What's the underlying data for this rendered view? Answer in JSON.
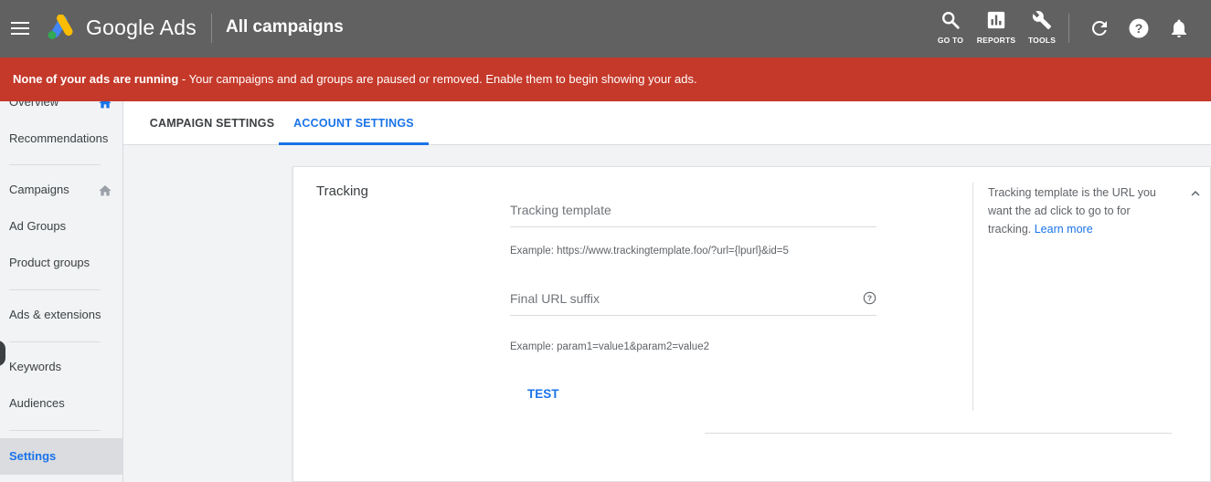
{
  "header": {
    "brand": "Google Ads",
    "page_title": "All campaigns",
    "tools": [
      {
        "label": "GO TO",
        "icon": "search-icon"
      },
      {
        "label": "REPORTS",
        "icon": "bar-chart-icon"
      },
      {
        "label": "TOOLS",
        "icon": "wrench-icon"
      }
    ],
    "icons": [
      "refresh-icon",
      "help-icon",
      "notifications-bell-icon"
    ]
  },
  "alert": {
    "bold": "None of your ads are running",
    "message": " - Your campaigns and ad groups are paused or removed. Enable them to begin showing your ads.",
    "color": "#c5392a"
  },
  "sidebar": {
    "items": [
      {
        "label": "Overview"
      },
      {
        "label": "Recommendations"
      },
      {
        "label": "Campaigns"
      },
      {
        "label": "Ad Groups"
      },
      {
        "label": "Product groups"
      },
      {
        "label": "Ads & extensions"
      },
      {
        "label": "Keywords"
      },
      {
        "label": "Audiences"
      },
      {
        "label": "Settings",
        "active": true
      }
    ]
  },
  "tabs": [
    {
      "label": "CAMPAIGN SETTINGS",
      "active": false
    },
    {
      "label": "ACCOUNT SETTINGS",
      "active": true
    }
  ],
  "tracking": {
    "section_title": "Tracking",
    "template_placeholder": "Tracking template",
    "template_value": "",
    "template_example": "Example: https://www.trackingtemplate.foo/?url={lpurl}&id=5",
    "suffix_placeholder": "Final URL suffix",
    "suffix_value": "",
    "suffix_example": "Example: param1=value1&param2=value2",
    "test_label": "TEST",
    "help_text": "Tracking template is the URL you want the ad click to go to for tracking.",
    "learn_more": "Learn more"
  },
  "colors": {
    "topbar": "#616161",
    "accent": "#1a73e8",
    "alert": "#c5392a"
  }
}
